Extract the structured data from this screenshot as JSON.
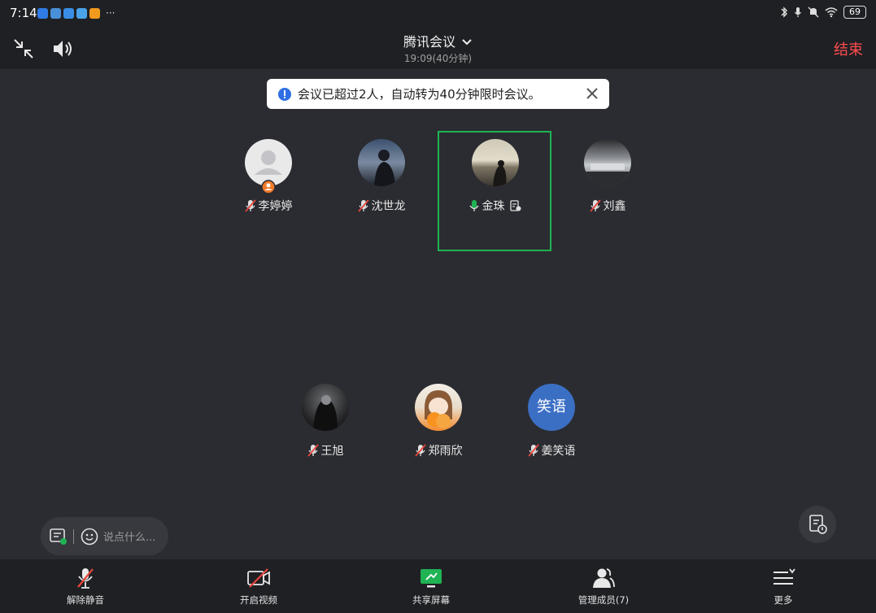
{
  "status_bar": {
    "time": "7:14",
    "more": "···",
    "battery": "69"
  },
  "header": {
    "title": "腾讯会议",
    "duration": "19:09(40分钟)",
    "end_label": "结束"
  },
  "notice": {
    "text": "会议已超过2人，自动转为40分钟限时会议。"
  },
  "participants": [
    {
      "name": "李婷婷",
      "avatar": "default-person",
      "mic": "muted",
      "host": true,
      "speaking": false
    },
    {
      "name": "沈世龙",
      "avatar": "photo",
      "mic": "muted",
      "speaking": false
    },
    {
      "name": "金珠",
      "avatar": "photo",
      "mic": "on",
      "speaking": true,
      "sharing_doc": true
    },
    {
      "name": "刘鑫",
      "avatar": "photo",
      "mic": "muted",
      "speaking": false
    },
    {
      "name": "王旭",
      "avatar": "photo",
      "mic": "muted",
      "speaking": false
    },
    {
      "name": "郑雨欣",
      "avatar": "photo",
      "mic": "muted",
      "speaking": false
    },
    {
      "name": "姜笑语",
      "avatar_text": "笑语",
      "mic": "muted",
      "speaking": false
    }
  ],
  "chat": {
    "placeholder": "说点什么..."
  },
  "toolbar": {
    "unmute_label": "解除静音",
    "video_label": "开启视频",
    "share_label": "共享屏幕",
    "members_label": "管理成员(7)",
    "more_label": "更多"
  },
  "colors": {
    "accent_green": "#1fb353",
    "end_red": "#ff4d4f",
    "mute_red": "#e8453c",
    "info_blue": "#2f6fe4"
  }
}
